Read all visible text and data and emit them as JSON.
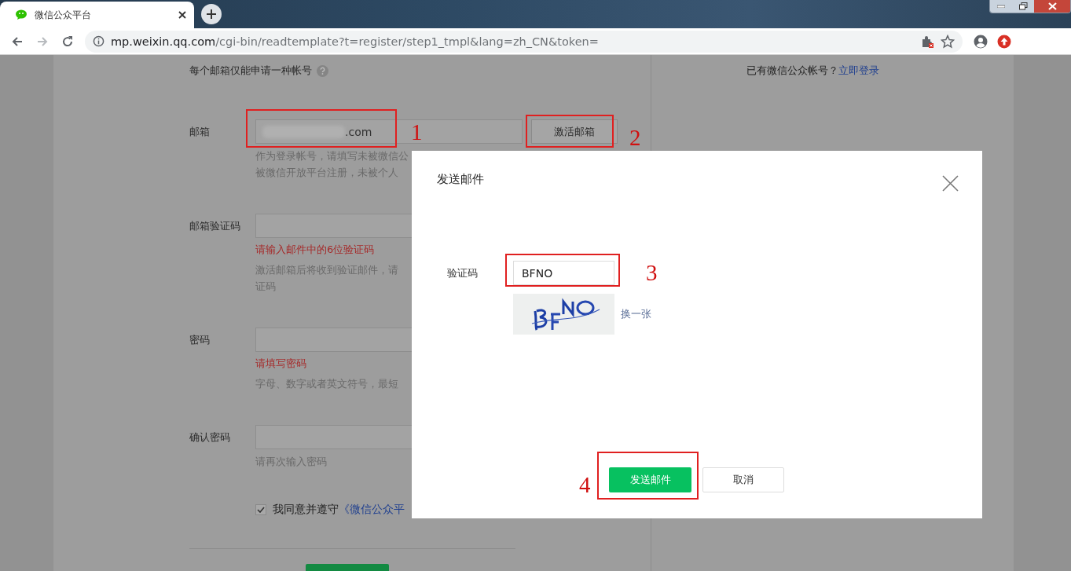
{
  "browser": {
    "tab_title": "微信公众平台",
    "url_host": "mp.weixin.qq.com",
    "url_path": "/cgi-bin/readtemplate?t=register/step1_tmpl&lang=zh_CN&token="
  },
  "page": {
    "notice": "每个邮箱仅能申请一种帐号",
    "login_prompt": "已有微信公众帐号？",
    "login_link": "立即登录",
    "fields": [
      {
        "label": "邮箱",
        "value": ".com",
        "redacted": true,
        "button": "激活邮箱",
        "hints": [
          "作为登录帐号，请填写未被微信公",
          "被微信开放平台注册，未被个人"
        ]
      },
      {
        "label": "邮箱验证码",
        "error": "请输入邮件中的6位验证码",
        "hints": [
          "激活邮箱后将收到验证邮件，请",
          "证码"
        ]
      },
      {
        "label": "密码",
        "error": "请填写密码",
        "hints": [
          "字母、数字或者英文符号，最短"
        ]
      },
      {
        "label": "确认密码",
        "hints": [
          "请再次输入密码"
        ]
      }
    ],
    "agreement": {
      "checked": true,
      "text": "我同意并遵守",
      "link": "《微信公众平"
    }
  },
  "dialog": {
    "title": "发送邮件",
    "captcha_label": "验证码",
    "captcha_value": "BFNO",
    "refresh": "换一张",
    "confirm": "发送邮件",
    "cancel": "取消"
  },
  "annotations": [
    {
      "number": "1"
    },
    {
      "number": "2"
    },
    {
      "number": "3"
    },
    {
      "number": "4"
    }
  ]
}
